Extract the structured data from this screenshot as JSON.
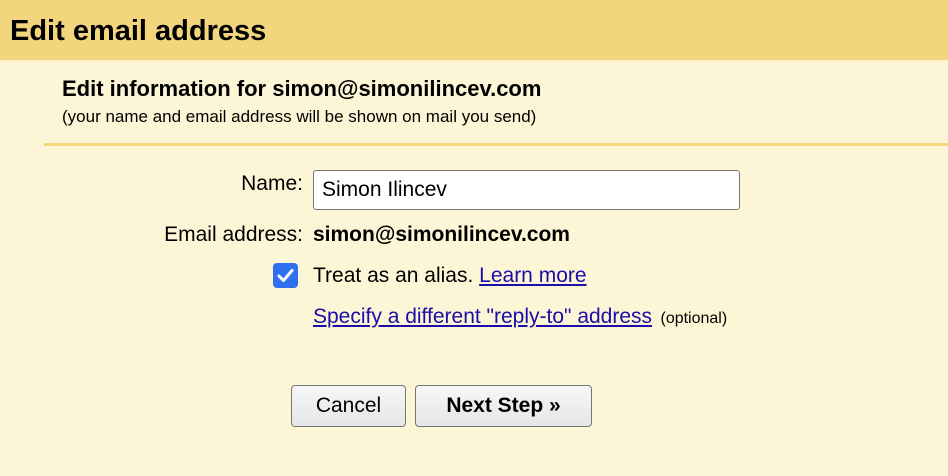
{
  "header": {
    "title": "Edit email address"
  },
  "intro": {
    "title": "Edit information for simon@simonilincev.com",
    "subtitle": "(your name and email address will be shown on mail you send)"
  },
  "form": {
    "name_label": "Name:",
    "name_value": "Simon Ilincev",
    "email_label": "Email address:",
    "email_value": "simon@simonilincev.com",
    "alias_checked": true,
    "alias_label": "Treat as an alias.",
    "learn_more": "Learn more",
    "replyto_link": "Specify a different \"reply-to\" address",
    "optional": "(optional)"
  },
  "buttons": {
    "cancel": "Cancel",
    "next": "Next Step »"
  },
  "colors": {
    "header_bg": "#f3d57e",
    "page_bg": "#fdf6d6",
    "checkbox": "#2f6ff0",
    "link": "#1a0dab"
  },
  "icons": {
    "checkbox": "checkmark-icon"
  }
}
